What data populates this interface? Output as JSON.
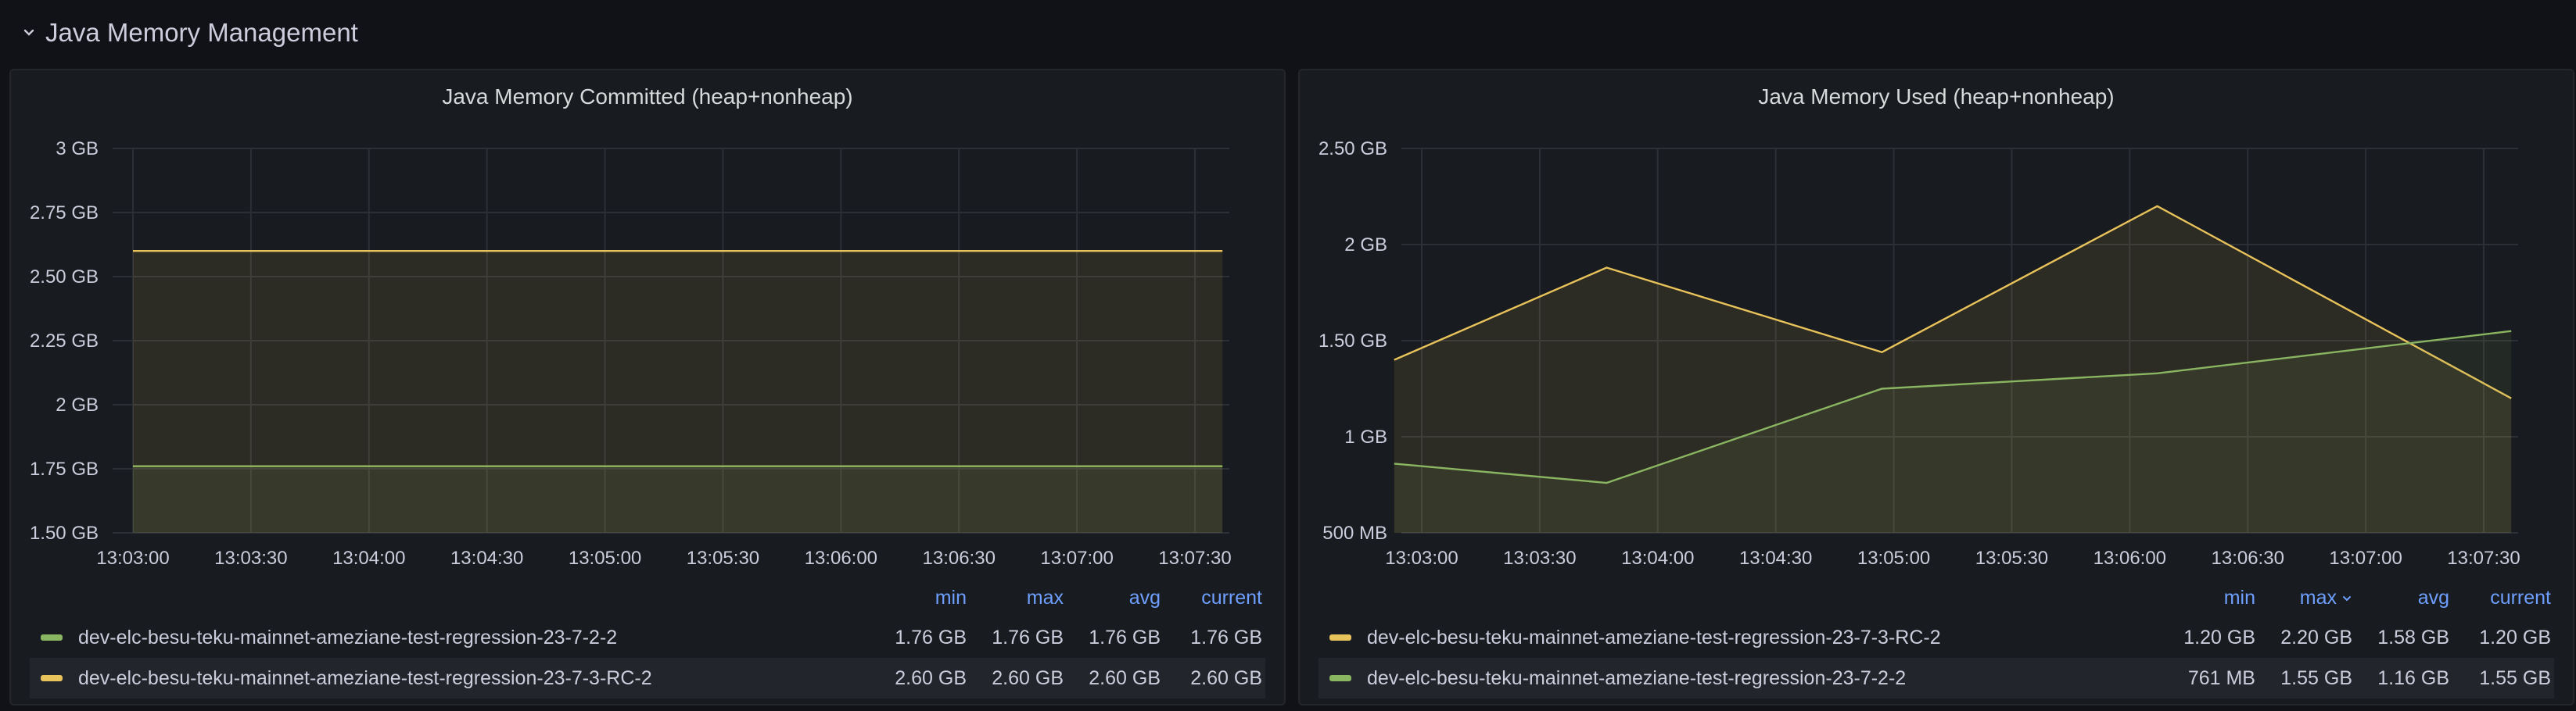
{
  "row": {
    "title": "Java Memory Management"
  },
  "colors": {
    "green": "#8ab561",
    "yellow": "#e8c25a"
  },
  "legend_headers": {
    "min": "min",
    "max": "max",
    "avg": "avg",
    "current": "current"
  },
  "panels": [
    {
      "title": "Java Memory Committed (heap+nonheap)",
      "chart_data": {
        "type": "area",
        "x": [
          "13:03:00",
          "13:03:30",
          "13:04:00",
          "13:04:30",
          "13:05:00",
          "13:05:30",
          "13:06:00",
          "13:06:30",
          "13:07:00",
          "13:07:30"
        ],
        "x_tick_labels": [
          "13:03:00",
          "13:03:30",
          "13:04:00",
          "13:04:30",
          "13:05:00",
          "13:05:30",
          "13:06:00",
          "13:06:30",
          "13:07:00",
          "13:07:30"
        ],
        "y_tick_labels": [
          "3 GB",
          "2.75 GB",
          "2.50 GB",
          "2.25 GB",
          "2 GB",
          "1.75 GB",
          "1.50 GB"
        ],
        "ylim": [
          1.5,
          3.0
        ],
        "y_unit": "GB",
        "grid": true,
        "series": [
          {
            "name": "dev-elc-besu-teku-mainnet-ameziane-test-regression-23-7-2-2",
            "color": "green",
            "points": [
              [
                "13:03:00",
                1.76
              ],
              [
                "13:07:37",
                1.76
              ]
            ]
          },
          {
            "name": "dev-elc-besu-teku-mainnet-ameziane-test-regression-23-7-3-RC-2",
            "color": "yellow",
            "points": [
              [
                "13:03:00",
                2.6
              ],
              [
                "13:07:37",
                2.6
              ]
            ]
          }
        ]
      },
      "legend": [
        {
          "name": "dev-elc-besu-teku-mainnet-ameziane-test-regression-23-7-2-2",
          "color": "green",
          "min": "1.76 GB",
          "max": "1.76 GB",
          "avg": "1.76 GB",
          "current": "1.76 GB"
        },
        {
          "name": "dev-elc-besu-teku-mainnet-ameziane-test-regression-23-7-3-RC-2",
          "color": "yellow",
          "min": "2.60 GB",
          "max": "2.60 GB",
          "avg": "2.60 GB",
          "current": "2.60 GB"
        }
      ]
    },
    {
      "title": "Java Memory Used (heap+nonheap)",
      "chart_data": {
        "type": "area",
        "x": [
          "13:03:00",
          "13:03:30",
          "13:04:00",
          "13:04:30",
          "13:05:00",
          "13:05:30",
          "13:06:00",
          "13:06:30",
          "13:07:00",
          "13:07:30"
        ],
        "x_tick_labels": [
          "13:03:00",
          "13:03:30",
          "13:04:00",
          "13:04:30",
          "13:05:00",
          "13:05:30",
          "13:06:00",
          "13:06:30",
          "13:07:00",
          "13:07:30"
        ],
        "y_tick_labels": [
          "2.50 GB",
          "2 GB",
          "1.50 GB",
          "1 GB",
          "500 MB"
        ],
        "ylim": [
          0.5,
          2.5
        ],
        "y_unit": "GB",
        "grid": true,
        "series": [
          {
            "name": "dev-elc-besu-teku-mainnet-ameziane-test-regression-23-7-3-RC-2",
            "color": "yellow",
            "points": [
              [
                "13:02:53",
                1.4
              ],
              [
                "13:03:47",
                1.88
              ],
              [
                "13:04:57",
                1.44
              ],
              [
                "13:06:07",
                2.2
              ],
              [
                "13:07:37",
                1.2
              ]
            ]
          },
          {
            "name": "dev-elc-besu-teku-mainnet-ameziane-test-regression-23-7-2-2",
            "color": "green",
            "points": [
              [
                "13:02:53",
                0.86
              ],
              [
                "13:03:47",
                0.76
              ],
              [
                "13:04:57",
                1.25
              ],
              [
                "13:06:07",
                1.33
              ],
              [
                "13:07:37",
                1.55
              ]
            ]
          }
        ]
      },
      "legend": [
        {
          "name": "dev-elc-besu-teku-mainnet-ameziane-test-regression-23-7-3-RC-2",
          "color": "yellow",
          "min": "1.20 GB",
          "max": "2.20 GB",
          "avg": "1.58 GB",
          "current": "1.20 GB"
        },
        {
          "name": "dev-elc-besu-teku-mainnet-ameziane-test-regression-23-7-2-2",
          "color": "green",
          "min": "761 MB",
          "max": "1.55 GB",
          "avg": "1.16 GB",
          "current": "1.55 GB"
        }
      ]
    }
  ]
}
